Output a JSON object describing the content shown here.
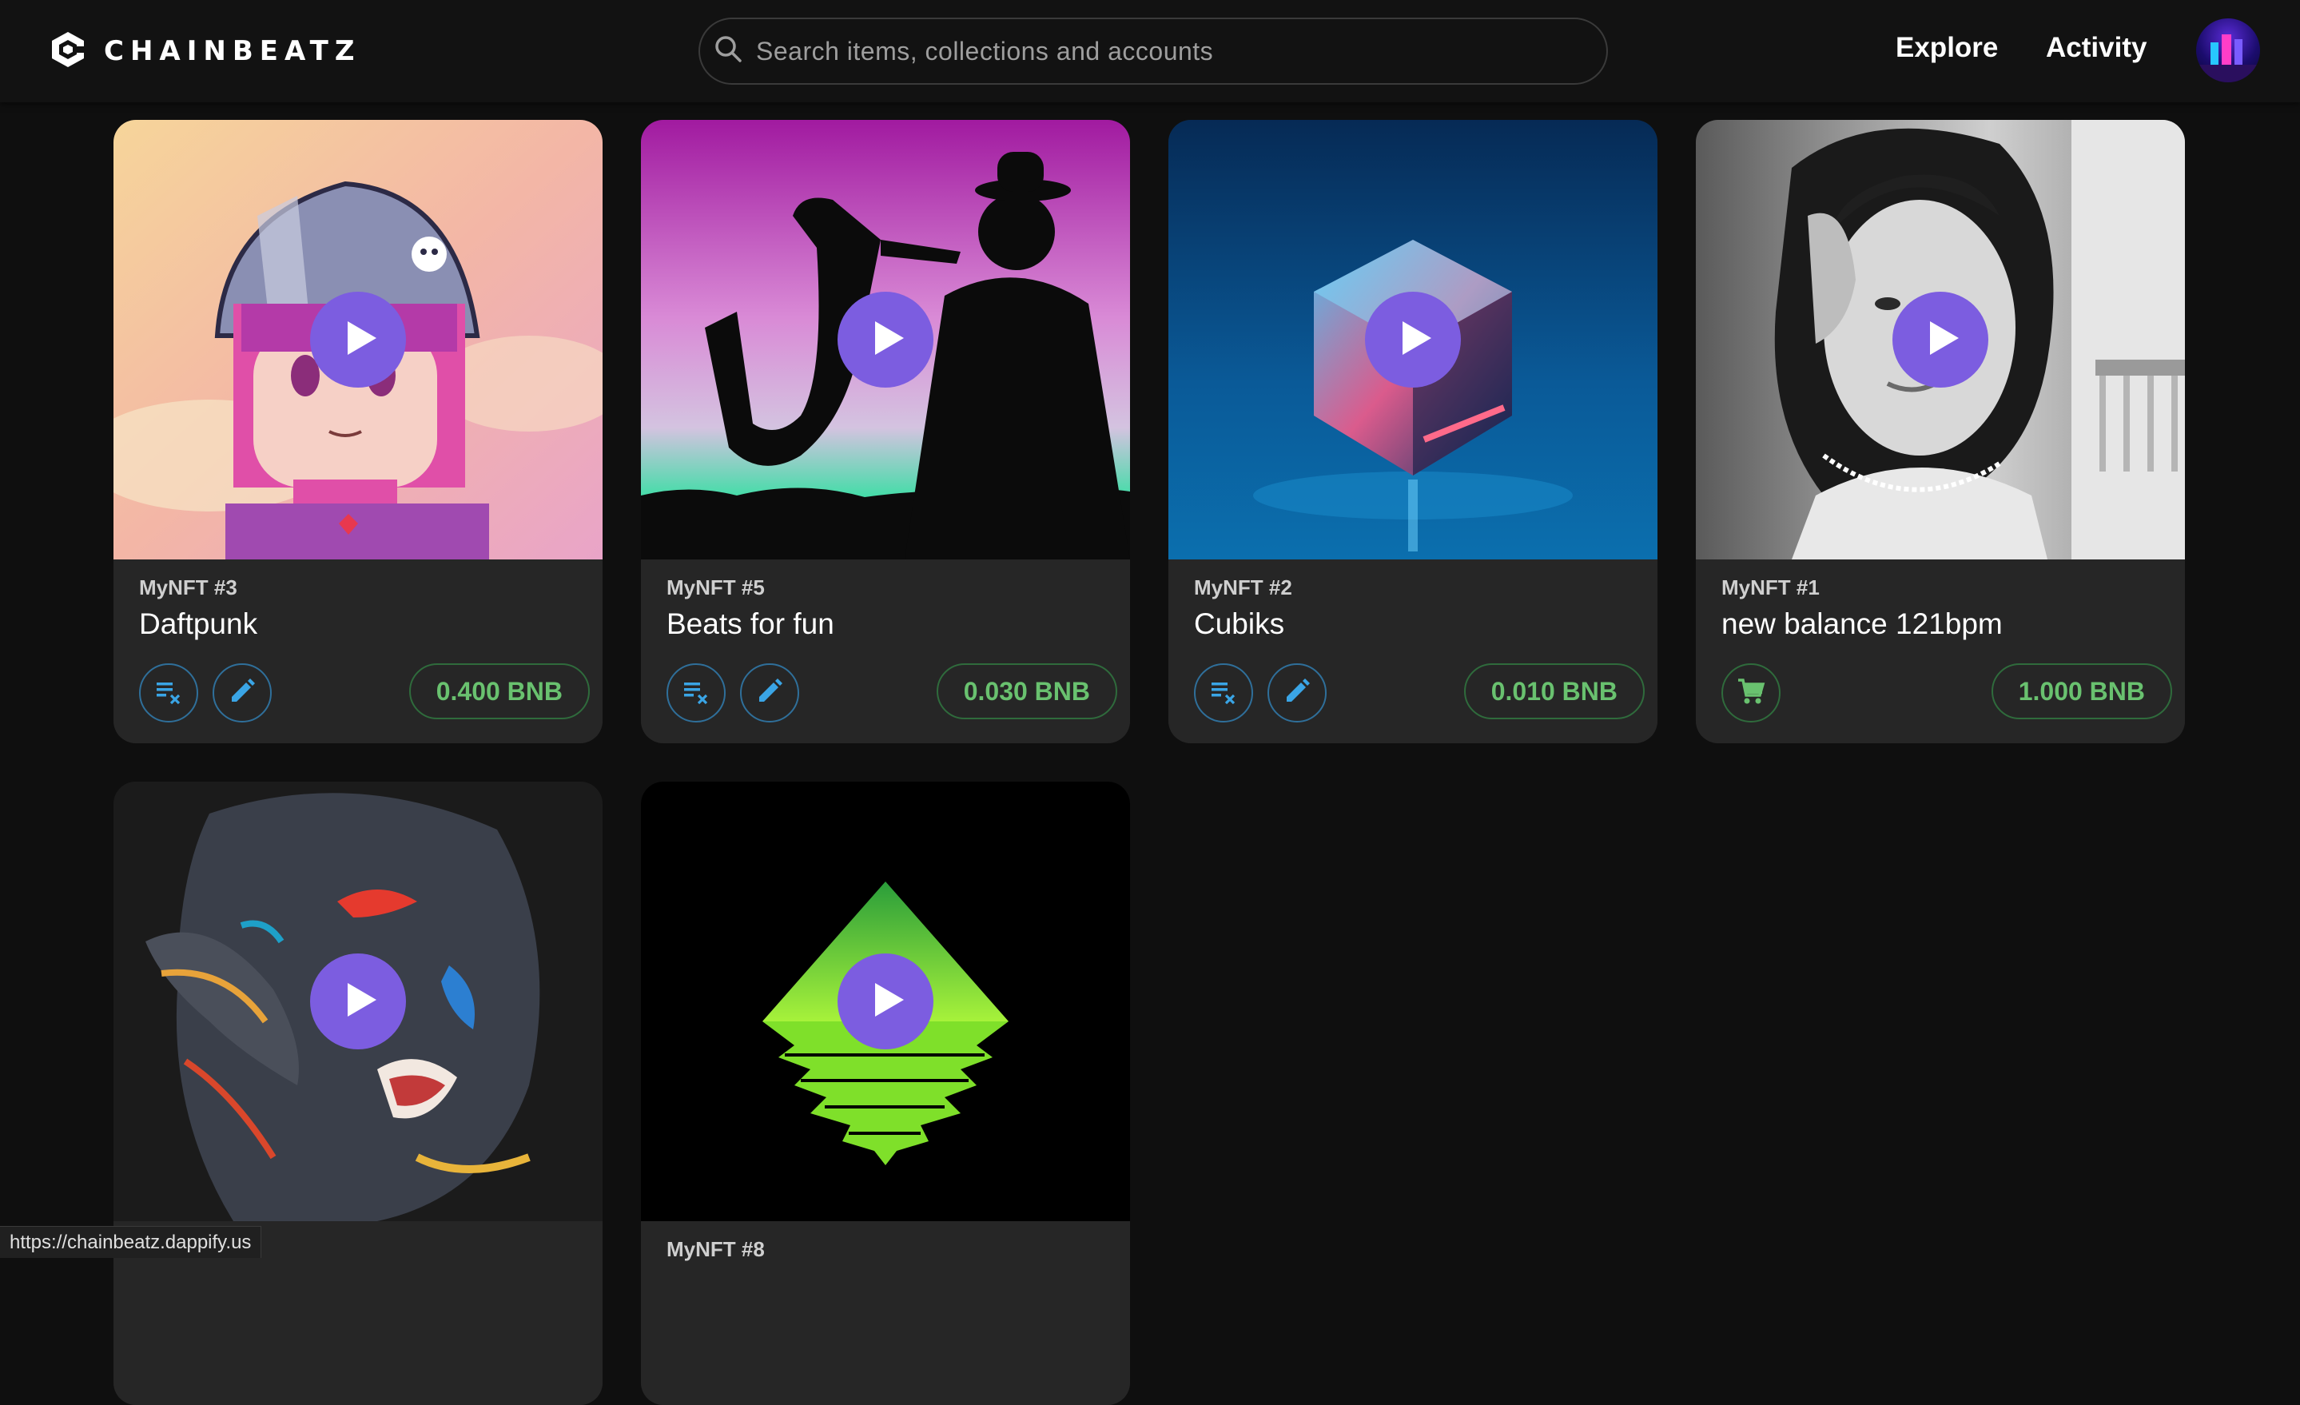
{
  "app": {
    "brand": "CHAINBEATZ",
    "logo_icon": "chainbeatz-logo-icon"
  },
  "search": {
    "placeholder": "Search items, collections and accounts",
    "icon": "search-icon"
  },
  "nav": {
    "explore": "Explore",
    "activity": "Activity"
  },
  "colors": {
    "background": "#0f0f0f",
    "card": "#1e1e1e",
    "accent_play": "#7c5de0",
    "price_green": "#69c16f",
    "icon_blue": "#3aa5e6"
  },
  "cards": [
    {
      "token": "MyNFT #3",
      "name": "Daftpunk",
      "price": "0.400 BNB",
      "actions": [
        "delist-icon",
        "edit-icon"
      ],
      "media": "anime-girl-artwork"
    },
    {
      "token": "MyNFT #5",
      "name": "Beats for fun",
      "price": "0.030 BNB",
      "actions": [
        "delist-icon",
        "edit-icon"
      ],
      "media": "saxophone-silhouette-artwork"
    },
    {
      "token": "MyNFT #2",
      "name": "Cubiks",
      "price": "0.010 BNB",
      "actions": [
        "delist-icon",
        "edit-icon"
      ],
      "media": "glass-cube-artwork"
    },
    {
      "token": "MyNFT #1",
      "name": "new balance 121bpm",
      "price": "1.000 BNB",
      "actions": [
        "cart-icon"
      ],
      "media": "portrait-photo-artwork"
    },
    {
      "token": "",
      "name": "",
      "price": "",
      "actions": [],
      "media": "painted-face-artwork"
    },
    {
      "token": "MyNFT #8",
      "name": "",
      "price": "",
      "actions": [],
      "media": "green-triangle-artwork"
    }
  ],
  "status_bar": {
    "url": "https://chainbeatz.dappify.us"
  }
}
